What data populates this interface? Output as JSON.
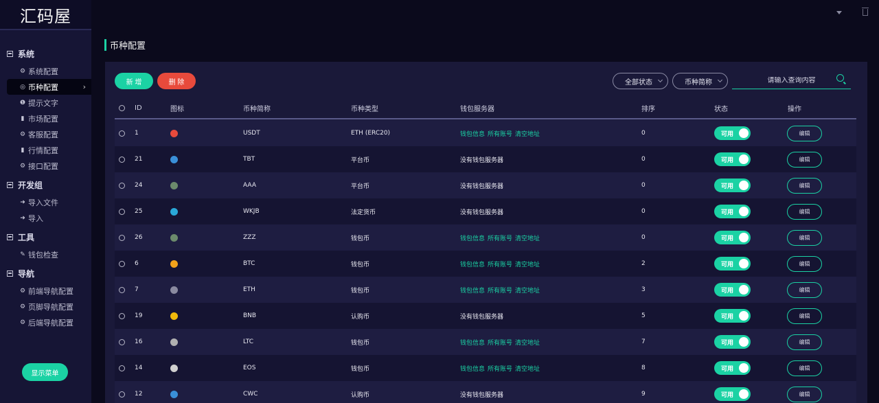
{
  "app": {
    "logo": "汇码屋"
  },
  "sidebar": {
    "groups": [
      {
        "label": "系统",
        "items": [
          {
            "label": "系统配置",
            "icon": "gear-icon"
          },
          {
            "label": "币种配置",
            "icon": "target-icon",
            "active": true
          },
          {
            "label": "提示文字",
            "icon": "info-icon"
          },
          {
            "label": "市场配置",
            "icon": "bar-chart-icon"
          },
          {
            "label": "客服配置",
            "icon": "gear-icon"
          },
          {
            "label": "行情配置",
            "icon": "bar-chart-icon"
          },
          {
            "label": "接口配置",
            "icon": "gear-icon"
          }
        ]
      },
      {
        "label": "开发组",
        "items": [
          {
            "label": "导入文件",
            "icon": "import-icon"
          },
          {
            "label": "导入",
            "icon": "import-icon"
          }
        ]
      },
      {
        "label": "工具",
        "items": [
          {
            "label": "钱包检查",
            "icon": "wrench-icon"
          }
        ]
      },
      {
        "label": "导航",
        "items": [
          {
            "label": "前端导航配置",
            "icon": "gear-icon"
          },
          {
            "label": "页脚导航配置",
            "icon": "gear-icon"
          },
          {
            "label": "后端导航配置",
            "icon": "gear-icon"
          }
        ]
      }
    ],
    "show_menu_label": "显示菜单"
  },
  "page": {
    "title": "币种配置"
  },
  "toolbar": {
    "add_label": "新 增",
    "delete_label": "删 除",
    "status_filter": "全部状态",
    "name_filter": "币种简称",
    "search_placeholder": "请输入查询内容"
  },
  "table": {
    "headers": {
      "id": "ID",
      "icon": "图标",
      "name": "币种简称",
      "type": "币种类型",
      "wallet": "钱包服务器",
      "sort": "排序",
      "status": "状态",
      "action": "操作"
    },
    "wallet_links": [
      "钱包信息",
      "所有账号",
      "清空地址"
    ],
    "toggle_label": "可用",
    "edit_label": "编辑",
    "accent": "#1bd2a4",
    "rows": [
      {
        "id": "1",
        "name": "USDT",
        "type": "ETH (ERC20)",
        "wallet": "links",
        "sort": "0",
        "icon_color": "#e84a3c"
      },
      {
        "id": "21",
        "name": "TBT",
        "type": "平台币",
        "wallet": "没有钱包服务器",
        "sort": "0",
        "icon_color": "#3a8fd8"
      },
      {
        "id": "24",
        "name": "AAA",
        "type": "平台币",
        "wallet": "没有钱包服务器",
        "sort": "0",
        "icon_color": "#6c8a6c"
      },
      {
        "id": "25",
        "name": "WKJB",
        "type": "法定货币",
        "wallet": "没有钱包服务器",
        "sort": "0",
        "icon_color": "#2aa8d8"
      },
      {
        "id": "26",
        "name": "ZZZ",
        "type": "钱包币",
        "wallet": "links",
        "sort": "0",
        "icon_color": "#6c8a6c"
      },
      {
        "id": "6",
        "name": "BTC",
        "type": "钱包币",
        "wallet": "links",
        "sort": "2",
        "icon_color": "#f2a21b"
      },
      {
        "id": "7",
        "name": "ETH",
        "type": "钱包币",
        "wallet": "links",
        "sort": "3",
        "icon_color": "#8a8aa0"
      },
      {
        "id": "19",
        "name": "BNB",
        "type": "认购币",
        "wallet": "没有钱包服务器",
        "sort": "5",
        "icon_color": "#f0b90b"
      },
      {
        "id": "16",
        "name": "LTC",
        "type": "钱包币",
        "wallet": "links",
        "sort": "7",
        "icon_color": "#b0b0b0"
      },
      {
        "id": "14",
        "name": "EOS",
        "type": "钱包币",
        "wallet": "links",
        "sort": "8",
        "icon_color": "#d0d0d0"
      },
      {
        "id": "12",
        "name": "CWC",
        "type": "认购币",
        "wallet": "没有钱包服务器",
        "sort": "9",
        "icon_color": "#3a8fd8"
      }
    ]
  }
}
